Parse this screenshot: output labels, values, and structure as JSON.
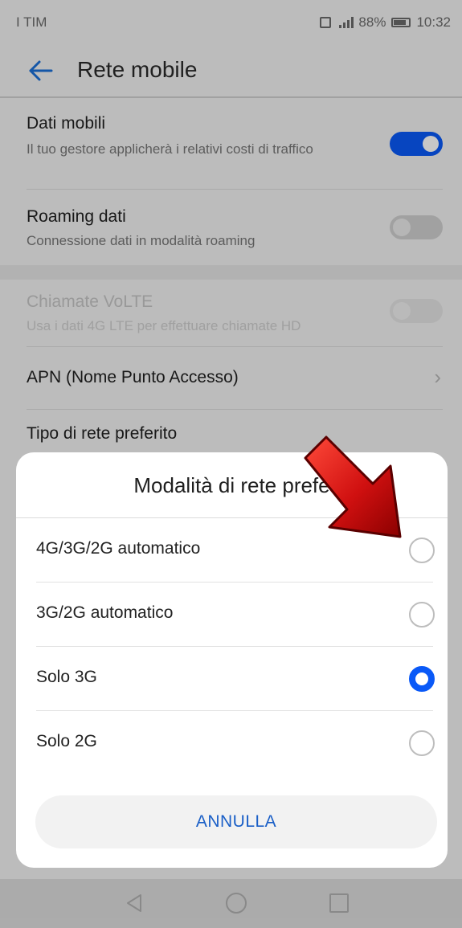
{
  "statusbar": {
    "carrier": "I TIM",
    "battery_text": "88%",
    "time": "10:32"
  },
  "appbar": {
    "back_icon": "arrow-left-icon",
    "title": "Rete mobile"
  },
  "settings": {
    "mobile_data": {
      "title": "Dati mobili",
      "subtitle": "Il tuo gestore applicherà i relativi costi di traffico",
      "toggle_on": true
    },
    "roaming": {
      "title": "Roaming dati",
      "subtitle": "Connessione dati in modalità roaming",
      "toggle_on": false
    },
    "volte": {
      "title": "Chiamate VoLTE",
      "subtitle": "Usa i dati 4G LTE per effettuare chiamate HD",
      "enabled": false
    },
    "apn": {
      "title": "APN (Nome Punto Accesso)",
      "icon": "chevron-right-icon"
    },
    "network_type": {
      "title": "Tipo di rete preferito"
    }
  },
  "dialog": {
    "title": "Modalità di rete prefe",
    "options": [
      {
        "label": "4G/3G/2G automatico",
        "selected": false
      },
      {
        "label": "3G/2G automatico",
        "selected": false
      },
      {
        "label": "Solo 3G",
        "selected": true
      },
      {
        "label": "Solo 2G",
        "selected": false
      }
    ],
    "cancel_label": "ANNULLA"
  },
  "overlay": {
    "annotation_icon": "red-arrow-icon"
  },
  "colors": {
    "accent": "#0a59f7",
    "cancel_text": "#1a5fc7",
    "annotation": "#d01010"
  },
  "navbar": {
    "icons": [
      "nav-back-icon",
      "nav-home-icon",
      "nav-recent-icon"
    ]
  }
}
